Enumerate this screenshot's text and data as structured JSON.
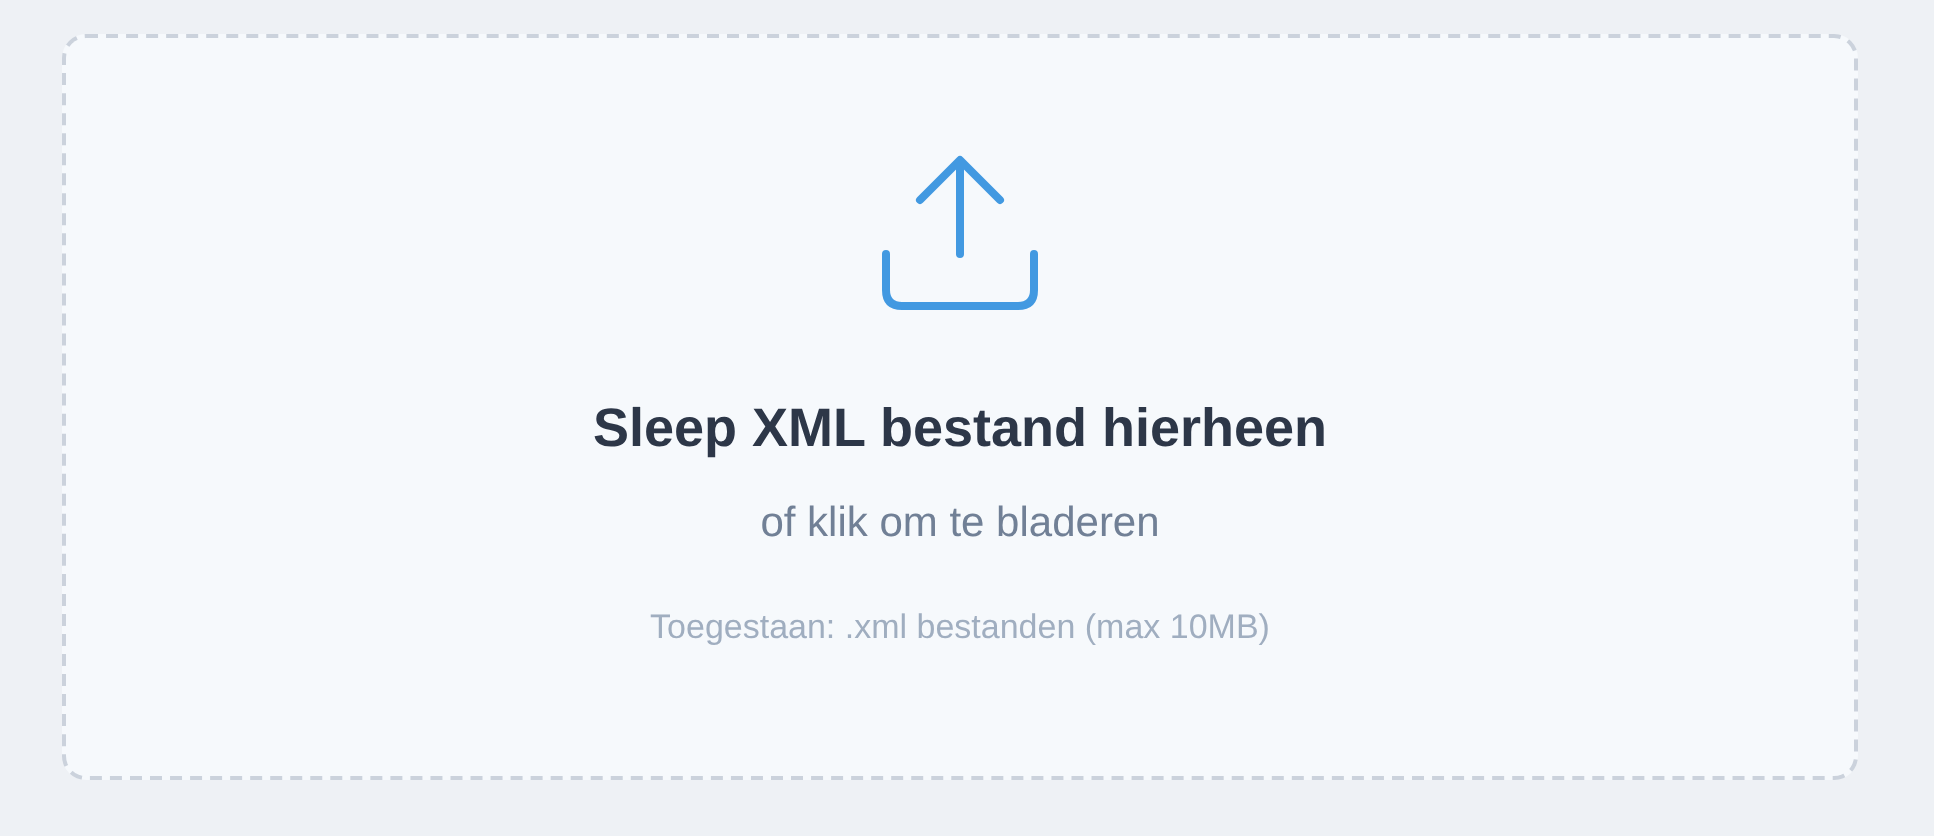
{
  "dropzone": {
    "title": "Sleep XML bestand hierheen",
    "subtitle": "of klik om te bladeren",
    "hint": "Toegestaan: .xml bestanden (max 10MB)"
  }
}
